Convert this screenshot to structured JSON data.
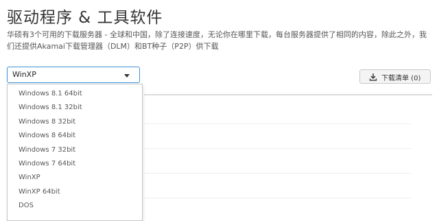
{
  "page": {
    "title": "驱动程序 & 工具软件",
    "description": "华硕有3个可用的下载服务器 - 全球和中国，除了连接速度，无论你在哪里下载，每台服务器提供了相同的内容，除此之外，我们还提供Akamai下载管理器（DLM）和BT种子（P2P）供下载"
  },
  "os_select": {
    "selected": "WinXP",
    "options": [
      "Windows 8.1 64bit",
      "Windows 8.1 32bit",
      "Windows 8 32bit",
      "Windows 8 64bit",
      "Windows 7 32bit",
      "Windows 7 64bit",
      "WinXP",
      "WinXP 64bit",
      "DOS"
    ]
  },
  "download_list": {
    "label": "下载清单 (0)",
    "icon": "download-icon"
  }
}
